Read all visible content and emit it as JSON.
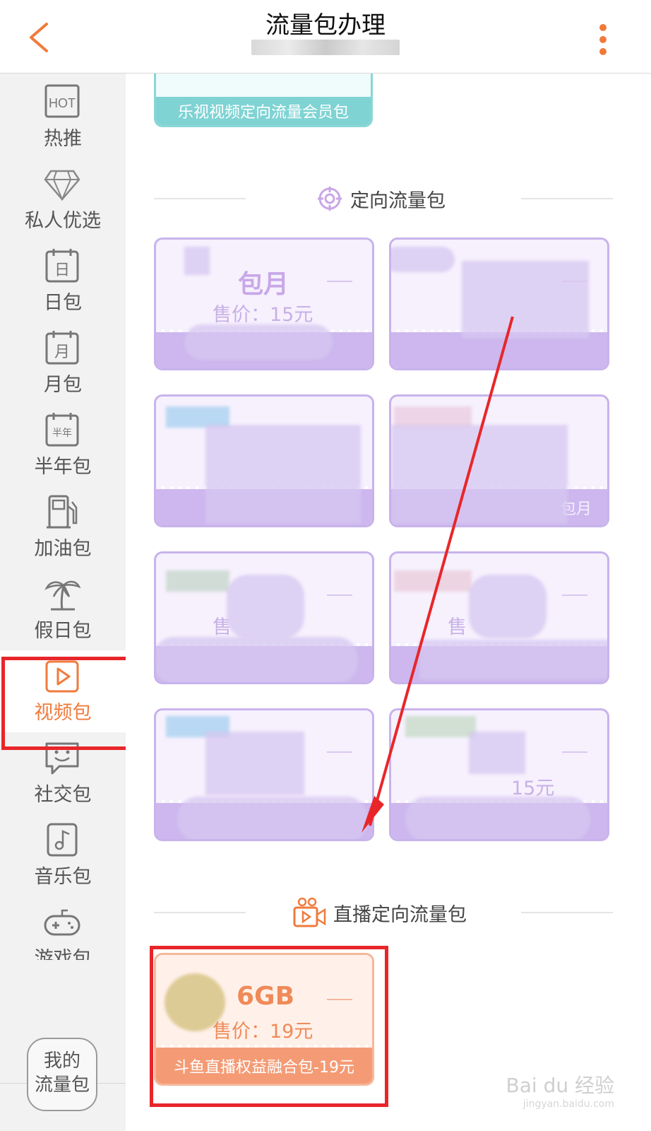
{
  "header": {
    "title": "流量包办理"
  },
  "sidebar": {
    "items": [
      {
        "label": "热推",
        "icon": "hot-icon"
      },
      {
        "label": "私人优选",
        "icon": "diamond-icon"
      },
      {
        "label": "日包",
        "icon": "calendar-day-icon"
      },
      {
        "label": "月包",
        "icon": "calendar-month-icon"
      },
      {
        "label": "半年包",
        "icon": "calendar-halfyear-icon"
      },
      {
        "label": "加油包",
        "icon": "fuel-icon"
      },
      {
        "label": "假日包",
        "icon": "palm-tree-icon"
      },
      {
        "label": "视频包",
        "icon": "video-play-icon"
      },
      {
        "label": "社交包",
        "icon": "chat-smile-icon"
      },
      {
        "label": "音乐包",
        "icon": "music-note-icon"
      },
      {
        "label": "游戏包",
        "icon": "gamepad-icon"
      }
    ],
    "active_index": 7,
    "my_package": "我的\n流量包"
  },
  "main": {
    "top_card": {
      "label": "乐视视频定向流量会员包"
    },
    "section_directed": {
      "title": "定向流量包",
      "icon": "target-icon"
    },
    "directed_cards": [
      {
        "big": "包月",
        "price": "售价：15元"
      },
      {
        "big": "",
        "price": ""
      },
      {
        "big": "",
        "price": ""
      },
      {
        "big": "",
        "price": "",
        "bottom": "包月"
      },
      {
        "big": "",
        "price": "售"
      },
      {
        "big": "",
        "price": "售"
      },
      {
        "big": "",
        "price": ""
      },
      {
        "big": "",
        "price": "15元"
      }
    ],
    "section_live": {
      "title": "直播定向流量包",
      "icon": "camera-icon"
    },
    "live_card": {
      "big": "6GB",
      "price": "售价：19元",
      "label": "斗鱼直播权益融合包-19元"
    }
  },
  "watermark": {
    "brand": "Bai du 经验",
    "url": "jingyan.baidu.com"
  },
  "colors": {
    "accent": "#f07a3c",
    "highlight": "#e8262a",
    "teal": "#7fd3d3",
    "purple": "#cdb7ee",
    "orange": "#f49b75"
  }
}
